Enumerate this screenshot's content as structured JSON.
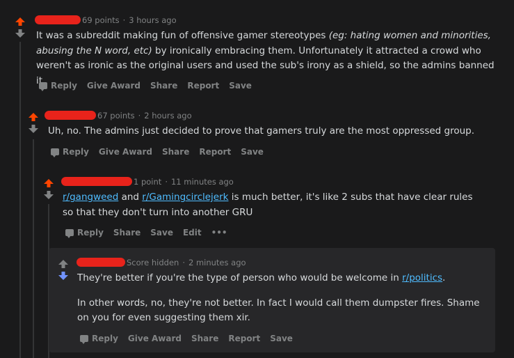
{
  "colors": {
    "upvote": "#ff4500",
    "downvote": "#7193ff",
    "neutral": "#818384",
    "link": "#4fbcff",
    "redaction": "#e8231b"
  },
  "comments": [
    {
      "points": "69 points",
      "time": "3 hours ago",
      "body_plain_1": "It was a subreddit making fun of offensive gamer stereotypes ",
      "body_italic": "(eg: hating women and minorities, abusing the N word, etc)",
      "body_plain_2": " by ironically embracing them. Unfortunately it attracted a crowd who weren't as ironic as the original users and used the sub's irony as a shield, so the admins banned it.",
      "actions": [
        "Reply",
        "Give Award",
        "Share",
        "Report",
        "Save"
      ]
    },
    {
      "points": "67 points",
      "time": "2 hours ago",
      "body": "Uh, no. The admins just decided to prove that gamers truly are the most oppressed group.",
      "actions": [
        "Reply",
        "Give Award",
        "Share",
        "Report",
        "Save"
      ]
    },
    {
      "points": "1 point",
      "time": "11 minutes ago",
      "link1": "r/gangweed",
      "mid": " and ",
      "link2": "r/Gamingcirclejerk",
      "rest": " is much better, it's like 2 subs that have clear rules so that they don't turn into another GRU",
      "actions": [
        "Reply",
        "Share",
        "Save",
        "Edit",
        "•••"
      ]
    },
    {
      "points": "Score hidden",
      "time": "2 minutes ago",
      "p1_text": "They're better if you're the type of person who would be welcome in ",
      "p1_link": "r/politics",
      "p1_end": ".",
      "p2": "In other words, no, they're not better. In fact I would call them dumpster fires. Shame on you for even suggesting them xir.",
      "actions": [
        "Reply",
        "Give Award",
        "Share",
        "Report",
        "Save"
      ]
    }
  ]
}
